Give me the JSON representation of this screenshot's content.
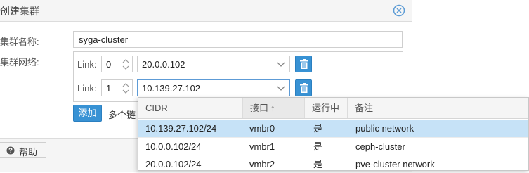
{
  "dialog": {
    "title": "创建集群",
    "cluster_name_label": "集群名称:",
    "cluster_name_value": "syga-cluster",
    "cluster_network_label": "集群网络:",
    "links": [
      {
        "label": "Link:",
        "number": "0",
        "address": "20.0.0.102"
      },
      {
        "label": "Link:",
        "number": "1",
        "address": "10.139.27.102"
      }
    ],
    "add_label": "添加",
    "add_hint": "多个链",
    "help_label": "帮助"
  },
  "dropdown": {
    "columns": [
      "CIDR",
      "接口",
      "运行中",
      "备注"
    ],
    "sort_indicator": "↑",
    "rows": [
      {
        "cidr": "10.139.27.102/24",
        "iface": "vmbr0",
        "active": "是",
        "comment": "public network"
      },
      {
        "cidr": "10.0.0.102/24",
        "iface": "vmbr1",
        "active": "是",
        "comment": "ceph-cluster"
      },
      {
        "cidr": "20.0.0.102/24",
        "iface": "vmbr2",
        "active": "是",
        "comment": "pve-cluster network"
      }
    ]
  },
  "colors": {
    "accent": "#3892d4",
    "selected_row": "#c6e2f7",
    "close_icon": "#5b9bd5"
  }
}
